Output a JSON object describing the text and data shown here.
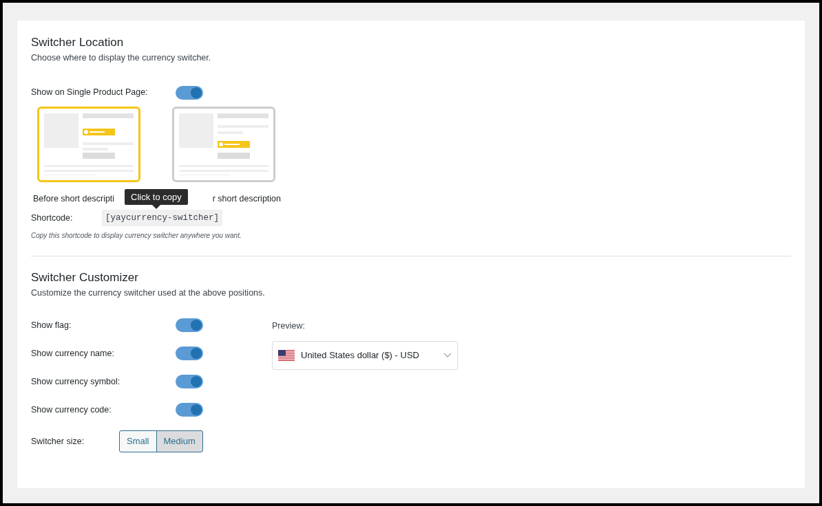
{
  "location": {
    "title": "Switcher Location",
    "description": "Choose where to display the currency switcher.",
    "single_product": {
      "label": "Show on Single Product Page:",
      "on": true
    },
    "layouts": [
      {
        "kind": "before",
        "label": "Before short descripti",
        "selected": true
      },
      {
        "kind": "after",
        "label": "r short description",
        "selected": false
      }
    ],
    "tooltip": "Click to copy",
    "shortcode": {
      "label": "Shortcode:",
      "value": "[yaycurrency-switcher]",
      "hint": "Copy this shortcode to display currency switcher anywhere you want."
    }
  },
  "customizer": {
    "title": "Switcher Customizer",
    "description": "Customize the currency switcher used at the above positions.",
    "toggles": [
      {
        "label": "Show flag:",
        "on": true
      },
      {
        "label": "Show currency name:",
        "on": true
      },
      {
        "label": "Show currency symbol:",
        "on": true
      },
      {
        "label": "Show currency code:",
        "on": true
      }
    ],
    "size": {
      "label": "Switcher size:",
      "options": [
        {
          "label": "Small",
          "selected": false
        },
        {
          "label": "Medium",
          "selected": true
        }
      ]
    },
    "preview": {
      "label": "Preview:",
      "value": "United States dollar ($) - USD"
    }
  }
}
